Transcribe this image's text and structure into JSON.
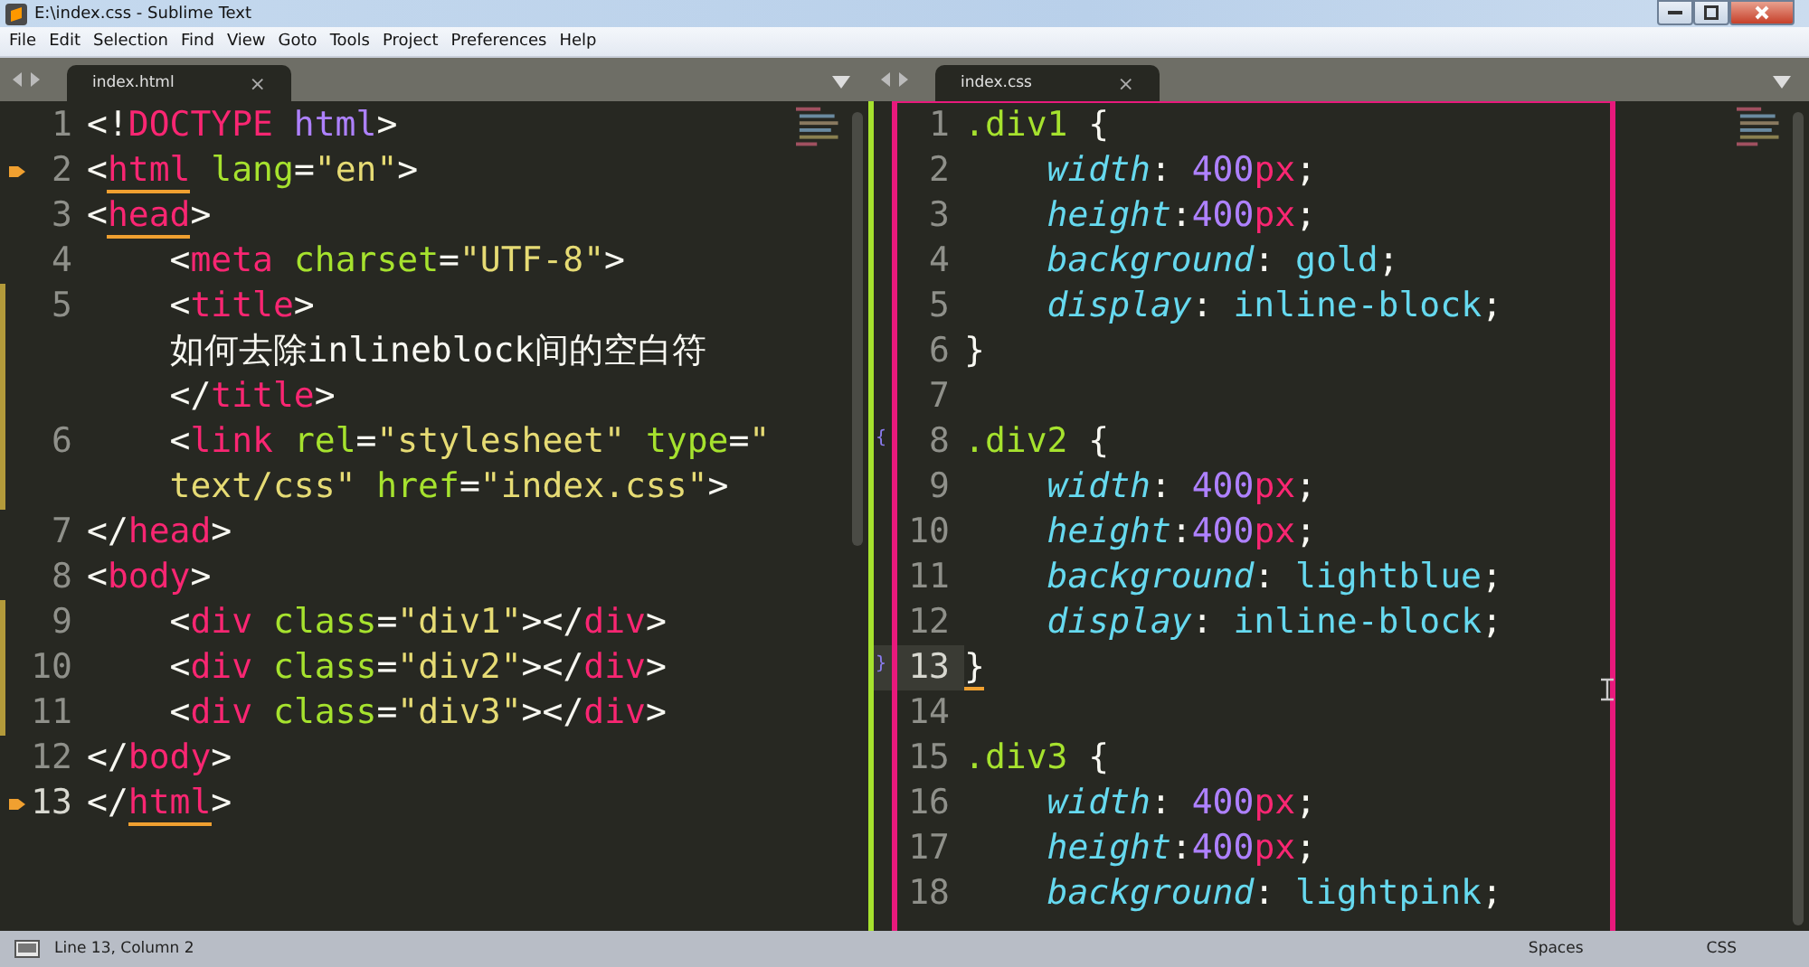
{
  "window": {
    "title": "E:\\index.css - Sublime Text"
  },
  "menu": [
    "File",
    "Edit",
    "Selection",
    "Find",
    "View",
    "Goto",
    "Tools",
    "Project",
    "Preferences",
    "Help"
  ],
  "panes": [
    {
      "kind": "html",
      "tab": {
        "label": "index.html",
        "close": "×"
      },
      "lines": [
        {
          "n": "1",
          "rows": [
            "<!DOCTYPE html>"
          ]
        },
        {
          "n": "2",
          "bookmark": true,
          "matched": true,
          "rows": [
            "<html lang=\"en\">"
          ]
        },
        {
          "n": "3",
          "matched": true,
          "rows": [
            "<head>"
          ]
        },
        {
          "n": "4",
          "rows": [
            "    <meta charset=\"UTF-8\">"
          ]
        },
        {
          "n": "5",
          "modified": true,
          "rows": [
            "    <title>",
            "    如何去除inlineblock间的空白符",
            "    </title>"
          ]
        },
        {
          "n": "6",
          "modified": true,
          "rows": [
            "    <link rel=\"stylesheet\" type=\"",
            "    text/css\" href=\"index.css\">"
          ]
        },
        {
          "n": "7",
          "rows": [
            "</head>"
          ]
        },
        {
          "n": "8",
          "rows": [
            "<body>"
          ]
        },
        {
          "n": "9",
          "modified": true,
          "rows": [
            "    <div class=\"div1\"></div>"
          ]
        },
        {
          "n": "10",
          "modified": true,
          "rows": [
            "    <div class=\"div2\"></div>"
          ]
        },
        {
          "n": "11",
          "modified": true,
          "rows": [
            "    <div class=\"div3\"></div>"
          ]
        },
        {
          "n": "12",
          "rows": [
            "</body>"
          ]
        },
        {
          "n": "13",
          "bookmark": true,
          "current": true,
          "matched": true,
          "rows": [
            "</html>"
          ]
        }
      ]
    },
    {
      "kind": "css",
      "tab": {
        "label": "index.css",
        "close": "×"
      },
      "lines": [
        {
          "n": "1",
          "rows": [
            ".div1 {"
          ]
        },
        {
          "n": "2",
          "rows": [
            "    width: 400px;"
          ]
        },
        {
          "n": "3",
          "rows": [
            "    height:400px;"
          ]
        },
        {
          "n": "4",
          "rows": [
            "    background: gold;"
          ]
        },
        {
          "n": "5",
          "rows": [
            "    display: inline-block;"
          ]
        },
        {
          "n": "6",
          "rows": [
            "}"
          ]
        },
        {
          "n": "7"
        },
        {
          "n": "8",
          "marker": "{",
          "rows": [
            ".div2 {"
          ]
        },
        {
          "n": "9",
          "rows": [
            "    width: 400px;"
          ]
        },
        {
          "n": "10",
          "rows": [
            "    height:400px;"
          ]
        },
        {
          "n": "11",
          "rows": [
            "    background: lightblue;"
          ]
        },
        {
          "n": "12",
          "rows": [
            "    display: inline-block;"
          ]
        },
        {
          "n": "13",
          "marker": "}",
          "current": true,
          "matched": true,
          "rows": [
            "}"
          ]
        },
        {
          "n": "14"
        },
        {
          "n": "15",
          "rows": [
            ".div3 {"
          ]
        },
        {
          "n": "16",
          "rows": [
            "    width: 400px;"
          ]
        },
        {
          "n": "17",
          "rows": [
            "    height:400px;"
          ]
        },
        {
          "n": "18",
          "rows": [
            "    background: lightpink;"
          ]
        }
      ]
    }
  ],
  "status_bar": {
    "position": "Line 13, Column 2",
    "indentation": "Spaces",
    "syntax": "CSS"
  }
}
